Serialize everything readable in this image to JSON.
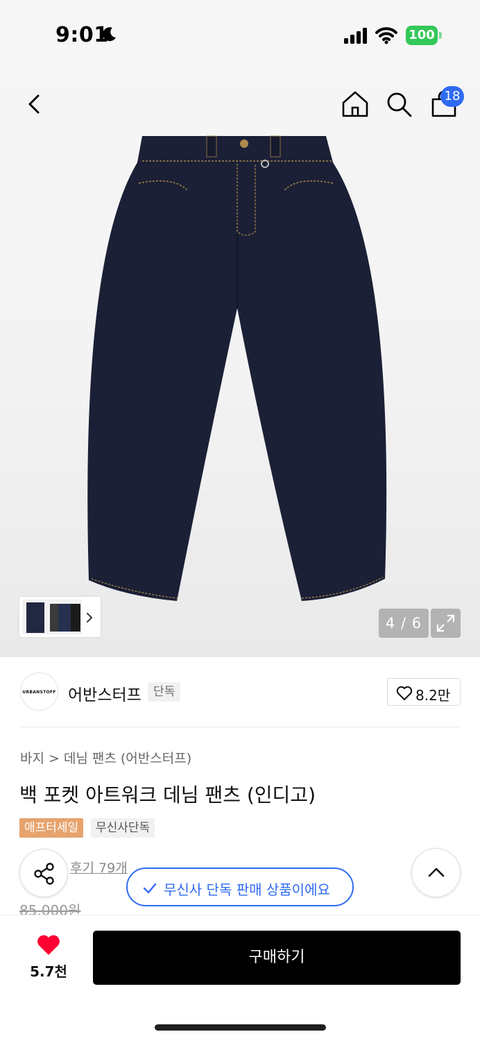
{
  "status_bar": {
    "time": "9:01",
    "battery": "100"
  },
  "header": {
    "cart_count": "18"
  },
  "gallery": {
    "counter": "4 / 6"
  },
  "brand": {
    "logo_text": "URBANSTOFF",
    "name": "어반스터프",
    "exclusive_tag": "단독",
    "likes": "8.2만"
  },
  "breadcrumb": {
    "category": "바지",
    "separator": ">",
    "subcategory": "데님 팬츠 (어반스터프)"
  },
  "product": {
    "title": "백 포켓 아트워크 데님 팬츠 (인디고)",
    "tags": [
      "애프터세일",
      "무신사단독"
    ],
    "reviews": "후기 79개",
    "original_price": "85,000원"
  },
  "toast": {
    "text": "무신사 단독 판매 상품이에요"
  },
  "bottom": {
    "wish_count": "5.7천",
    "buy_label": "구매하기"
  },
  "colors": {
    "accent_blue": "#2f6bf2",
    "heart_red": "#ff0033",
    "sale_tag": "#e6a36e",
    "denim": "#1c2238"
  }
}
